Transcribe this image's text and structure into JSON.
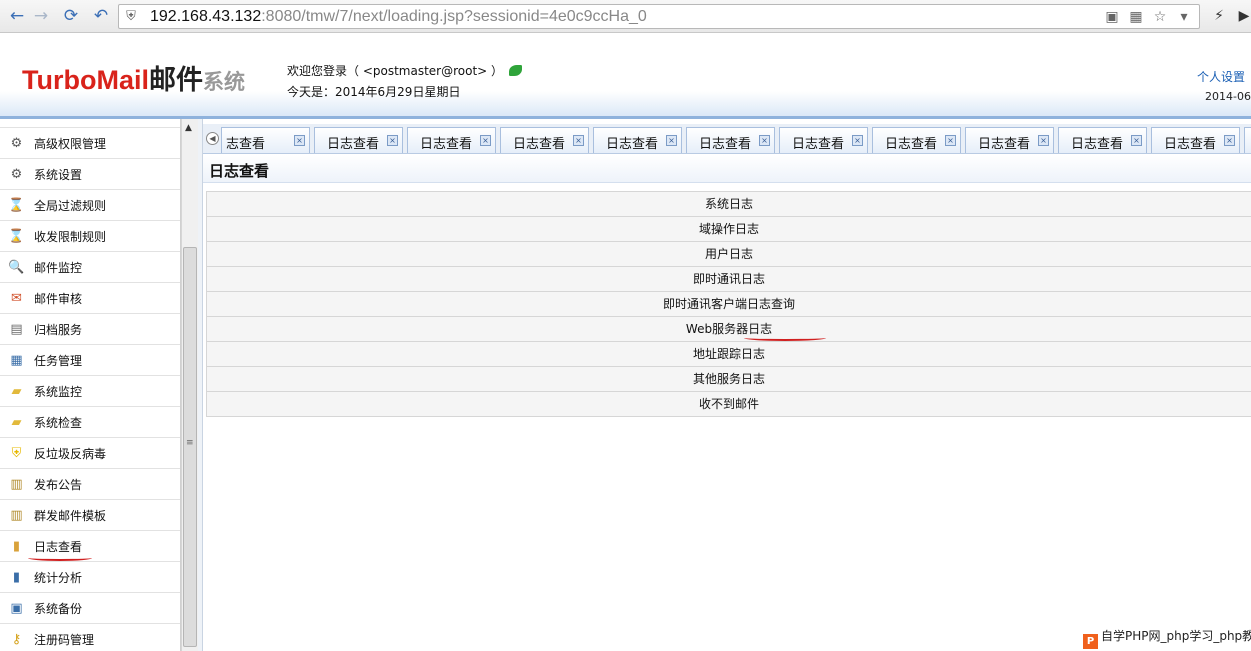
{
  "browser": {
    "url_host": "192.168.43.132",
    "url_rest": ":8080/tmw/7/next/loading.jsp?sessionid=4e0c9ccHa_0"
  },
  "header": {
    "logo_turbo": "TurboMail",
    "logo_mail": "邮件",
    "logo_sys": "系统",
    "welcome_text": "欢迎您登录（ <postmaster@root> ）",
    "today_text": "今天是：2014年6月29日星期日",
    "personal_settings": "个人设置",
    "date_right": "2014-06-"
  },
  "sidebar": {
    "items": [
      {
        "label": "高级权限管理",
        "icon": "gear-icon"
      },
      {
        "label": "系统设置",
        "icon": "gear-icon"
      },
      {
        "label": "全局过滤规则",
        "icon": "hourglass-icon"
      },
      {
        "label": "收发限制规则",
        "icon": "hourglass-icon"
      },
      {
        "label": "邮件监控",
        "icon": "magnifier-icon"
      },
      {
        "label": "邮件审核",
        "icon": "mail-check-icon"
      },
      {
        "label": "归档服务",
        "icon": "archive-icon"
      },
      {
        "label": "任务管理",
        "icon": "calendar-icon"
      },
      {
        "label": "系统监控",
        "icon": "folder-icon"
      },
      {
        "label": "系统检查",
        "icon": "folder-icon"
      },
      {
        "label": "反垃圾反病毒",
        "icon": "shield-icon"
      },
      {
        "label": "发布公告",
        "icon": "notepad-icon"
      },
      {
        "label": "群发邮件模板",
        "icon": "notepad-icon"
      },
      {
        "label": "日志查看",
        "icon": "log-icon"
      },
      {
        "label": "统计分析",
        "icon": "bar-chart-icon"
      },
      {
        "label": "系统备份",
        "icon": "backup-icon"
      },
      {
        "label": "注册码管理",
        "icon": "key-icon"
      }
    ]
  },
  "tabs": {
    "first_partial": "志查看",
    "label": "日志查看",
    "last_partial": "日志"
  },
  "content": {
    "title": "日志查看",
    "logs": [
      "系统日志",
      "域操作日志",
      "用户日志",
      "即时通讯日志",
      "即时通讯客户端日志查询",
      "Web服务器日志",
      "地址跟踪日志",
      "其他服务日志",
      "收不到邮件"
    ]
  },
  "watermark": {
    "logo": "P",
    "text": "自学PHP网_php学习_php教"
  }
}
